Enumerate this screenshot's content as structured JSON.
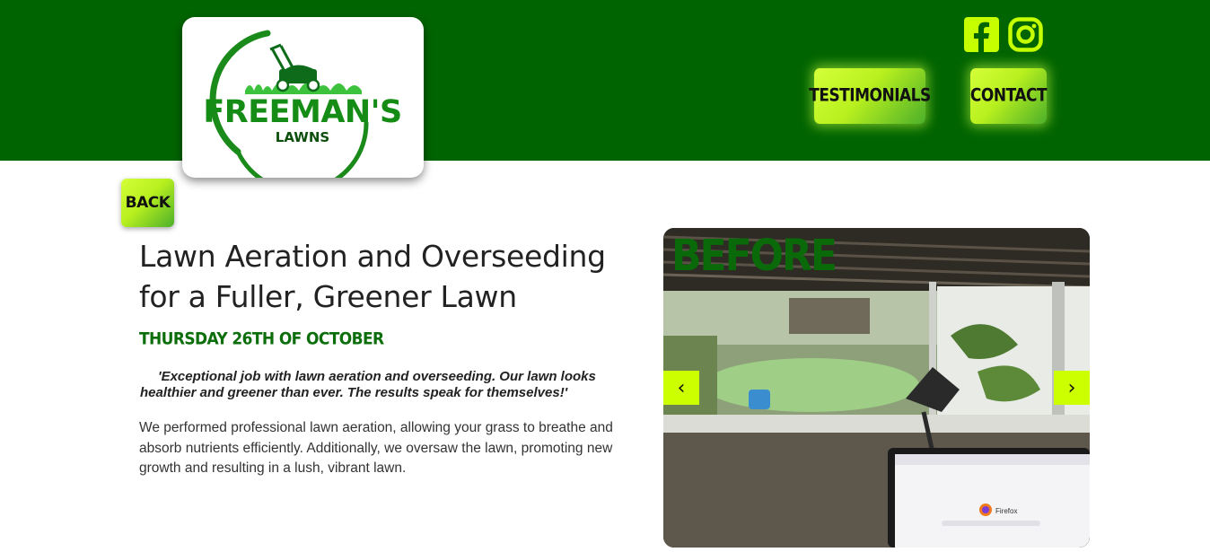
{
  "brand": {
    "name_line1": "FREEMAN'S",
    "name_line2": "LAWNS"
  },
  "social": {
    "facebook_icon": "facebook-icon",
    "instagram_icon": "instagram-icon",
    "icon_color": "#c5ff00"
  },
  "nav": {
    "testimonials_label": "TESTIMONIALS",
    "contact_label": "CONTACT"
  },
  "back_label": "BACK",
  "article": {
    "title": "Lawn Aeration and Overseeding for a Fuller, Greener Lawn",
    "date": "THURSDAY 26TH OF OCTOBER",
    "quote": "'Exceptional job with lawn aeration and overseeding. Our lawn looks healthier and greener than ever. The results speak for themselves!'",
    "body": "We performed professional lawn aeration, allowing your grass to breathe and absorb nutrients efficiently. Additionally, we oversaw the lawn, promoting new growth and resulting in a lush, vibrant lawn."
  },
  "carousel": {
    "label": "BEFORE",
    "prev_arrow": "‹",
    "next_arrow": "›",
    "screen_text": "Firefox"
  },
  "colors": {
    "header_bg": "#006400",
    "accent": "#ccff00",
    "date_green": "#0b6e0b"
  }
}
